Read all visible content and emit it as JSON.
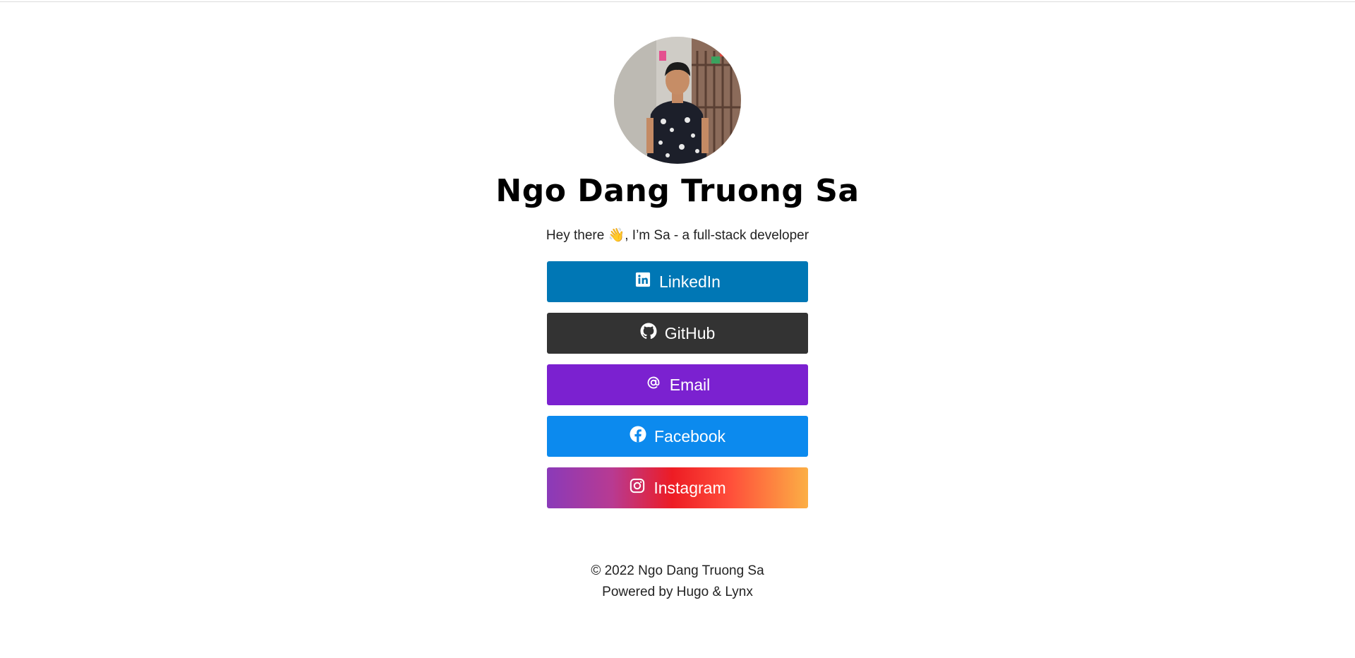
{
  "profile": {
    "name": "Ngo Dang Truong Sa",
    "tagline": "Hey there 👋, I’m Sa - a full-stack developer"
  },
  "links": [
    {
      "label": "LinkedIn",
      "icon": "linkedin-icon",
      "color": "#0077b5"
    },
    {
      "label": "GitHub",
      "icon": "github-icon",
      "color": "#333333"
    },
    {
      "label": "Email",
      "icon": "at-icon",
      "color": "#7b21d0"
    },
    {
      "label": "Facebook",
      "icon": "facebook-icon",
      "color": "#0c8aee"
    },
    {
      "label": "Instagram",
      "icon": "instagram-icon",
      "color": "gradient #8a3ab9 → #ed1c24 → #fcaf45"
    }
  ],
  "footer": {
    "copyright": "© 2022 Ngo Dang Truong Sa",
    "powered": "Powered by Hugo & Lynx"
  }
}
